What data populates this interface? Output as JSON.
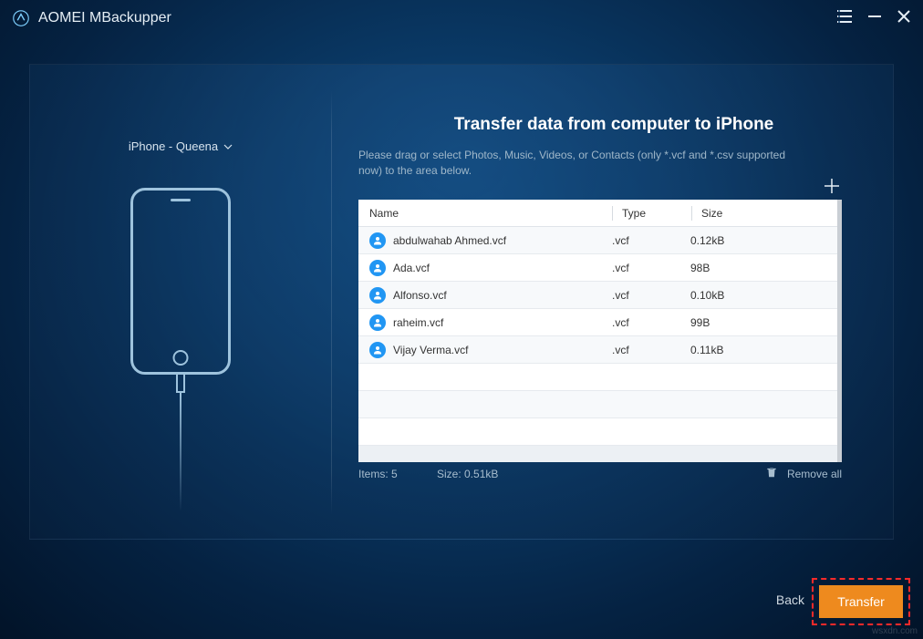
{
  "app": {
    "title": "AOMEI MBackupper"
  },
  "device": {
    "label": "iPhone - Queena"
  },
  "main": {
    "heading": "Transfer data from computer to iPhone",
    "subtext": "Please drag or select Photos, Music, Videos, or Contacts (only *.vcf and *.csv supported now) to the area below."
  },
  "table": {
    "headers": {
      "name": "Name",
      "type": "Type",
      "size": "Size"
    },
    "rows": [
      {
        "name": "abdulwahab Ahmed.vcf",
        "type": ".vcf",
        "size": "0.12kB"
      },
      {
        "name": "Ada.vcf",
        "type": ".vcf",
        "size": "98B"
      },
      {
        "name": "Alfonso.vcf",
        "type": ".vcf",
        "size": "0.10kB"
      },
      {
        "name": "raheim.vcf",
        "type": ".vcf",
        "size": "99B"
      },
      {
        "name": "Vijay Verma.vcf",
        "type": ".vcf",
        "size": "0.11kB"
      }
    ]
  },
  "status": {
    "items": "Items: 5",
    "size": "Size: 0.51kB",
    "remove_all": "Remove all"
  },
  "footer": {
    "back": "Back",
    "transfer": "Transfer"
  },
  "icons": {
    "menu": "menu-icon",
    "minimize": "minimize-icon",
    "close": "close-icon",
    "chevron": "chevron-down-icon",
    "plus": "plus-icon",
    "trash": "trash-icon",
    "contact": "contact-icon"
  },
  "watermark": "wsxdn.com"
}
